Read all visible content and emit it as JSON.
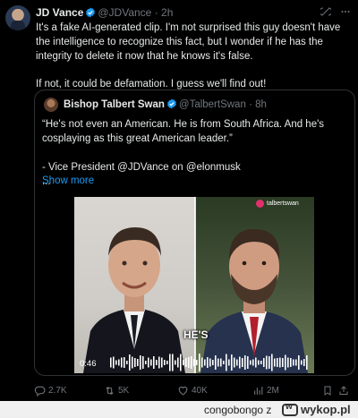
{
  "post": {
    "author_name": "JD Vance",
    "handle": "@JDVance",
    "separator": "·",
    "time": "2h",
    "text_p1": "It's a fake AI-generated clip. I'm not surprised this guy doesn't have the intelligence to recognize this fact, but I wonder if he has the integrity to delete it now that he knows it's false.",
    "text_p2": "If not, it could be defamation. I guess we'll find out!",
    "icons": [
      "grok-icon",
      "more-icon"
    ]
  },
  "quote": {
    "author_name": "Bishop Talbert Swan",
    "handle": "@TalbertSwan",
    "separator": "·",
    "time": "8h",
    "text_p1": "“He's not even an American. He is from South Africa. And he's cosplaying as this great American leader.”",
    "text_p2": "- Vice President @JDVance on @elonmusk",
    "ellipsis": "...",
    "show_more": "Show more"
  },
  "video": {
    "watermark": "talbertswan",
    "caption": "HE'S",
    "timestamp": "0:46"
  },
  "actions": {
    "replies": "2.7K",
    "reposts": "5K",
    "likes": "40K",
    "views": "2M"
  },
  "footer": {
    "username": "congobongo",
    "suffix": "z",
    "site": "wykop.pl"
  },
  "colors": {
    "accent": "#1d9bf0",
    "muted": "#71767b",
    "background": "#000000"
  }
}
